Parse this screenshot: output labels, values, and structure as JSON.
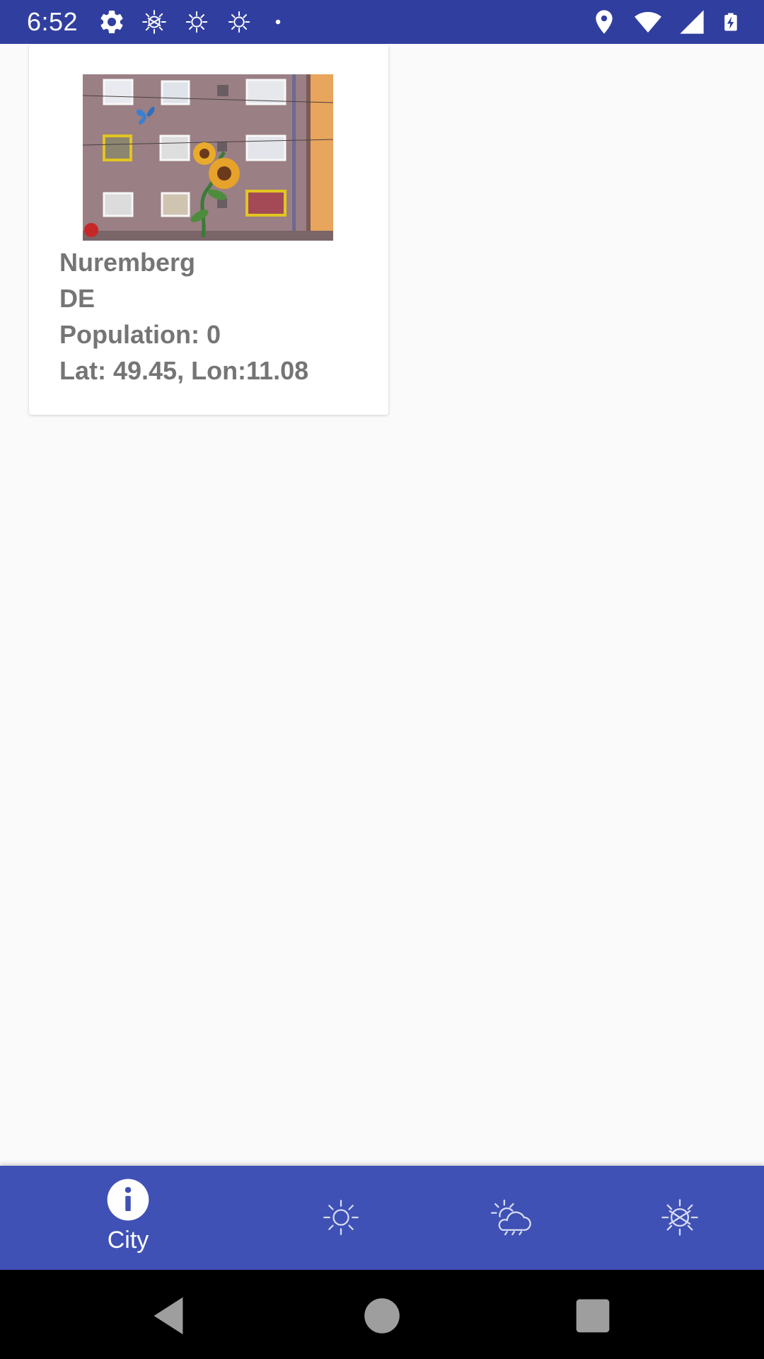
{
  "status_bar": {
    "time": "6:52",
    "left_icons": [
      "settings-gear-icon",
      "sun-crossed-icon",
      "sun-icon",
      "sun-icon",
      "dot-icon"
    ],
    "right_icons": [
      "location-pin-icon",
      "wifi-icon",
      "cell-signal-icon",
      "battery-charging-icon"
    ]
  },
  "city_card": {
    "name": "Nuremberg",
    "country": "DE",
    "population": "Population: 0",
    "coordinates": "Lat: 49.45, Lon:11.08"
  },
  "bottom_nav": {
    "items": [
      {
        "label": "City",
        "icon": "info-icon",
        "selected": true
      },
      {
        "label": "",
        "icon": "sun-icon",
        "selected": false
      },
      {
        "label": "",
        "icon": "sun-cloud-icon",
        "selected": false
      },
      {
        "label": "",
        "icon": "sun-crossed-icon",
        "selected": false
      }
    ]
  },
  "system_nav": [
    "back-icon",
    "home-icon",
    "recents-icon"
  ],
  "colors": {
    "status_bar": "#303f9f",
    "primary": "#3f51b5",
    "card_text": "#757575",
    "background": "#fafafa"
  }
}
